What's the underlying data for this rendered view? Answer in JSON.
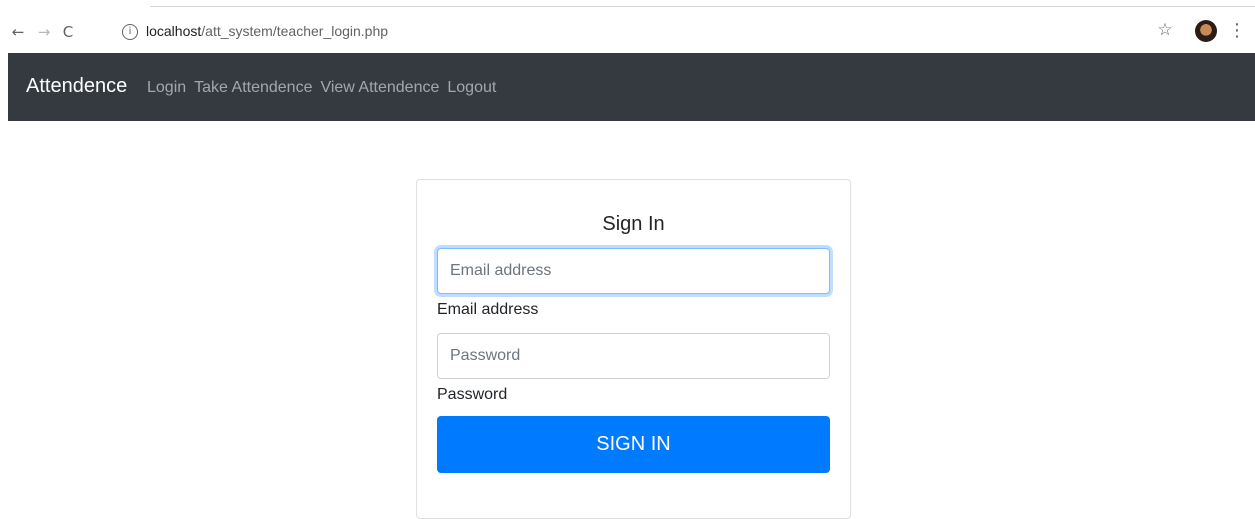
{
  "browser": {
    "url_host": "localhost",
    "url_path": "/att_system/teacher_login.php"
  },
  "navbar": {
    "brand": "Attendence",
    "links": [
      "Login",
      "Take Attendence",
      "View Attendence",
      "Logout"
    ]
  },
  "form": {
    "title": "Sign In",
    "email_placeholder": "Email address",
    "email_label": "Email address",
    "password_placeholder": "Password",
    "password_label": "Password",
    "submit_label": "SIGN IN"
  },
  "colors": {
    "navbar_bg": "#343a40",
    "primary": "#007bff"
  }
}
